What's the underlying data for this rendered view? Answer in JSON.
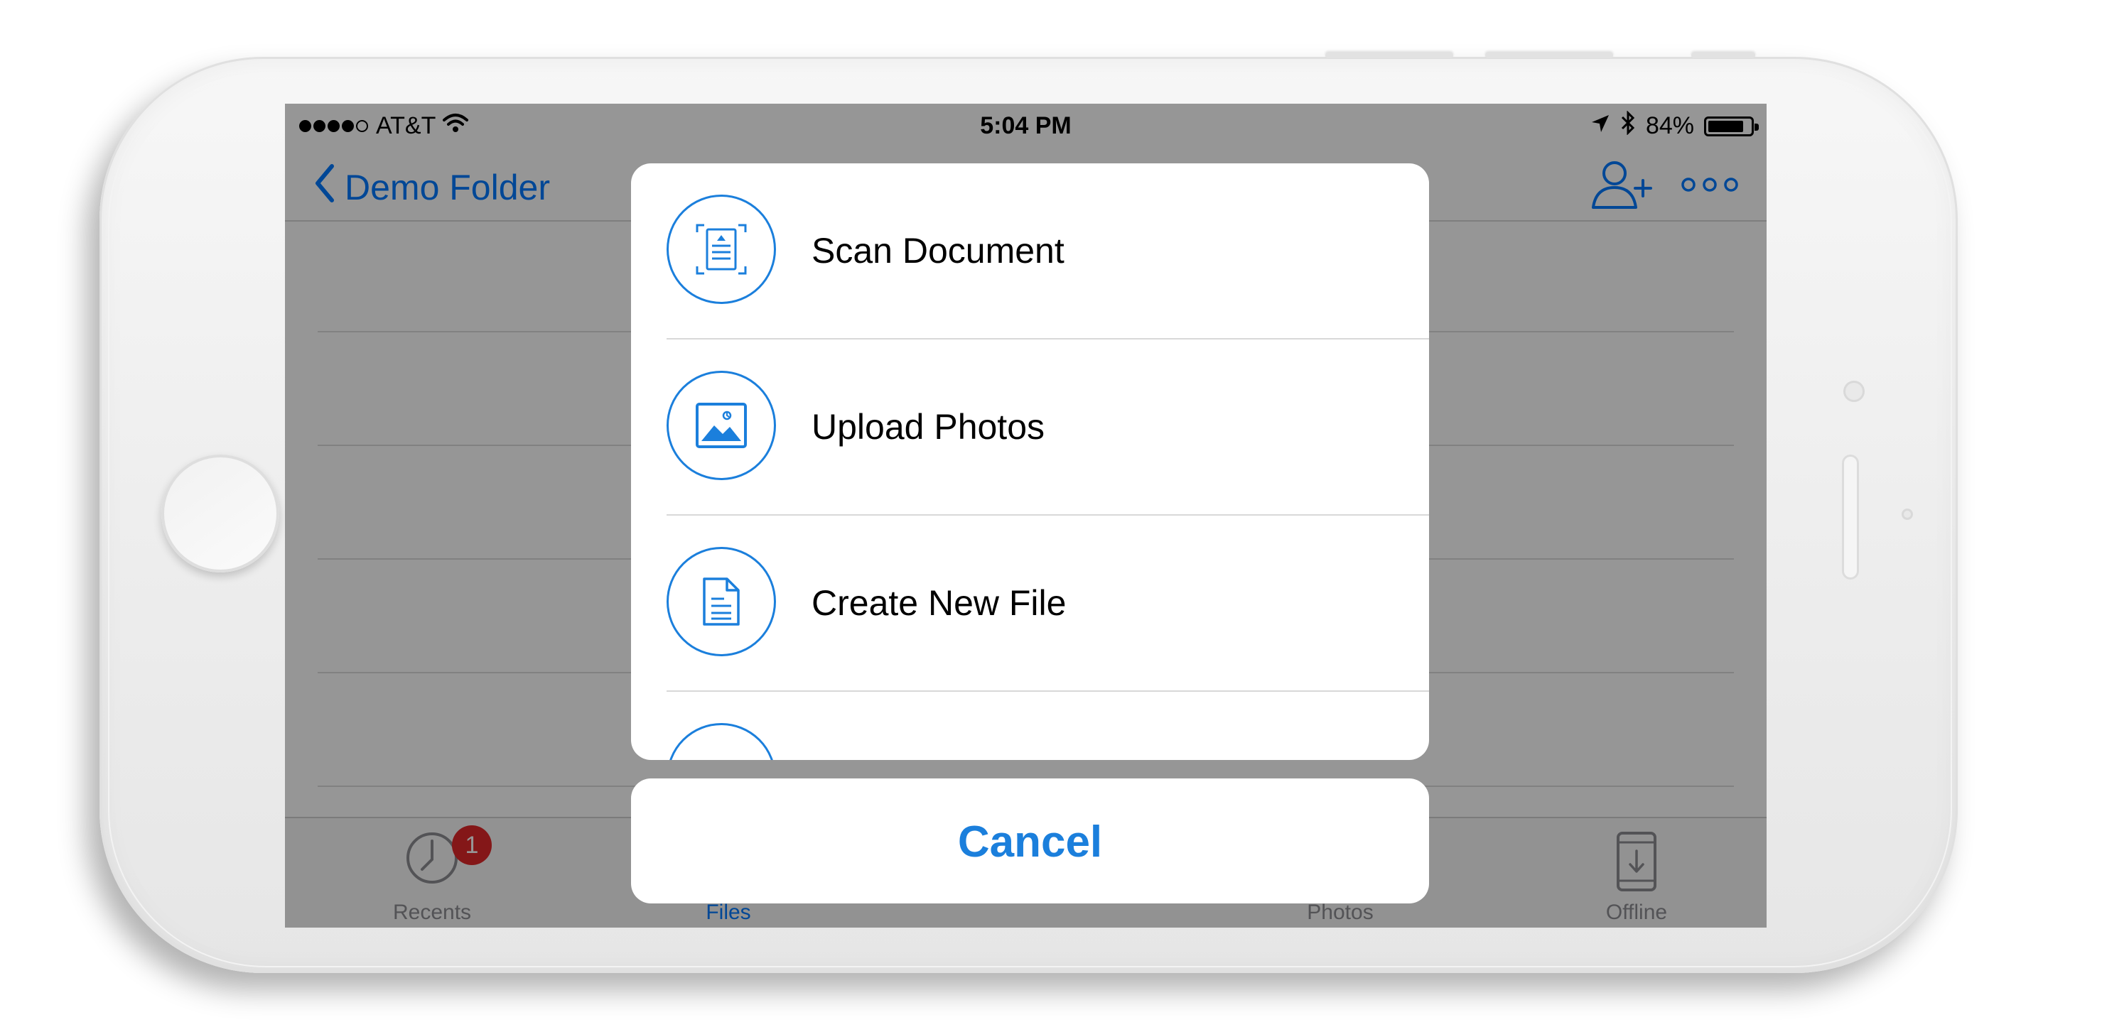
{
  "status_bar": {
    "carrier": "AT&T",
    "time": "5:04 PM",
    "battery_percent": "84%",
    "battery_level": 0.84
  },
  "nav": {
    "back_label": "Demo Folder"
  },
  "tabs": [
    {
      "label": "Recents",
      "badge": "1"
    },
    {
      "label": "Files"
    },
    {
      "label": "Photos"
    },
    {
      "label": "Offline"
    }
  ],
  "action_sheet": {
    "items": [
      {
        "label": "Scan Document",
        "icon": "scan-document-icon"
      },
      {
        "label": "Upload Photos",
        "icon": "upload-photos-icon"
      },
      {
        "label": "Create New File",
        "icon": "create-file-icon"
      }
    ],
    "cancel_label": "Cancel"
  },
  "colors": {
    "accent": "#1b7fdc",
    "badge": "#e0282a",
    "overlay": "rgba(0,0,0,0.41)"
  }
}
